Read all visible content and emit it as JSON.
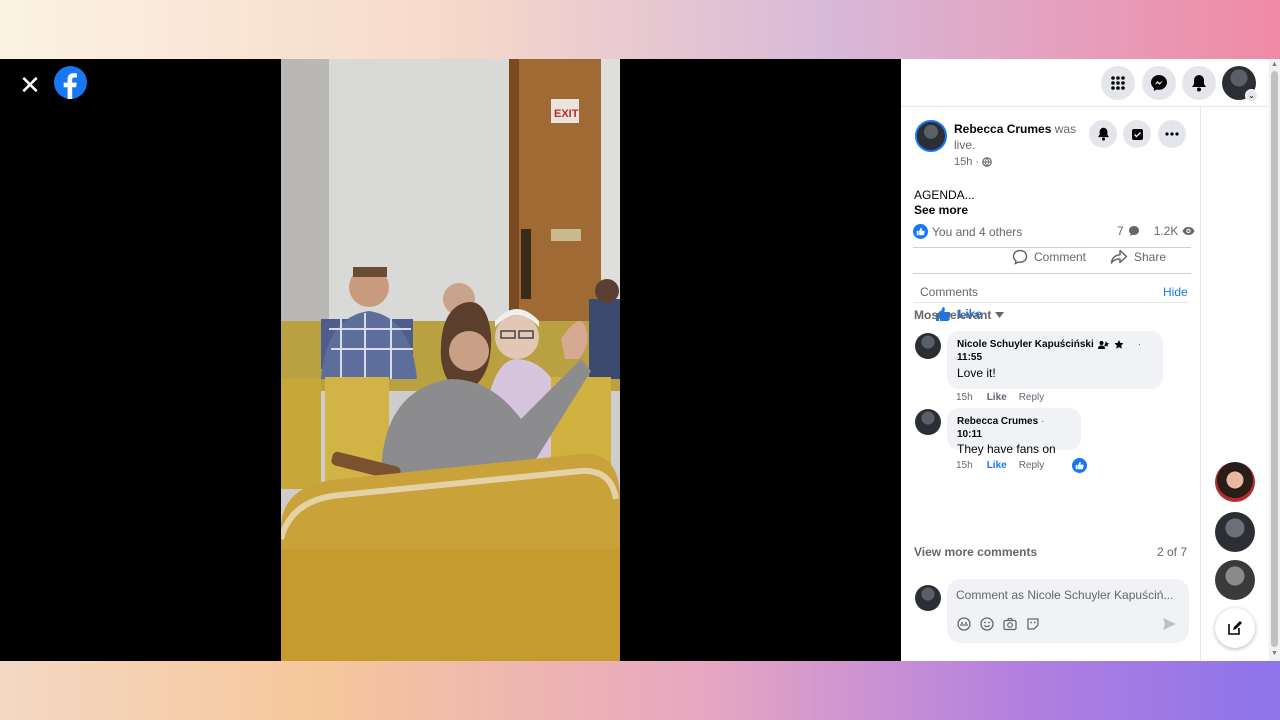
{
  "viewer": {
    "close_icon": "close-icon",
    "logo_icon": "facebook-logo"
  },
  "post": {
    "author": "Rebecca Crumes",
    "status": "was live.",
    "time": "15h",
    "privacy_icon": "globe-icon",
    "text": "AGENDA...",
    "see_more": "See more",
    "reactions": "You and 4 others",
    "comment_count": "7",
    "views": "1.2K",
    "actions": {
      "like": "Like",
      "comment": "Comment",
      "share": "Share"
    },
    "accent": "#1877f2"
  },
  "comments_section": {
    "title": "Comments",
    "hide": "Hide",
    "sort": "Most relevant",
    "items": [
      {
        "author": "Nicole Schuyler Kapuściński",
        "timestamp": "11:55",
        "text": "Love it!",
        "age": "15h",
        "like": "Like",
        "reply": "Reply"
      },
      {
        "author": "Rebecca Crumes",
        "timestamp": "10:11",
        "text": "They have fans on",
        "age": "15h",
        "like": "Like",
        "reply": "Reply"
      }
    ],
    "view_more": "View more comments",
    "pager": "2 of 7",
    "composer_placeholder": "Comment as Nicole Schuyler Kapuściń..."
  }
}
